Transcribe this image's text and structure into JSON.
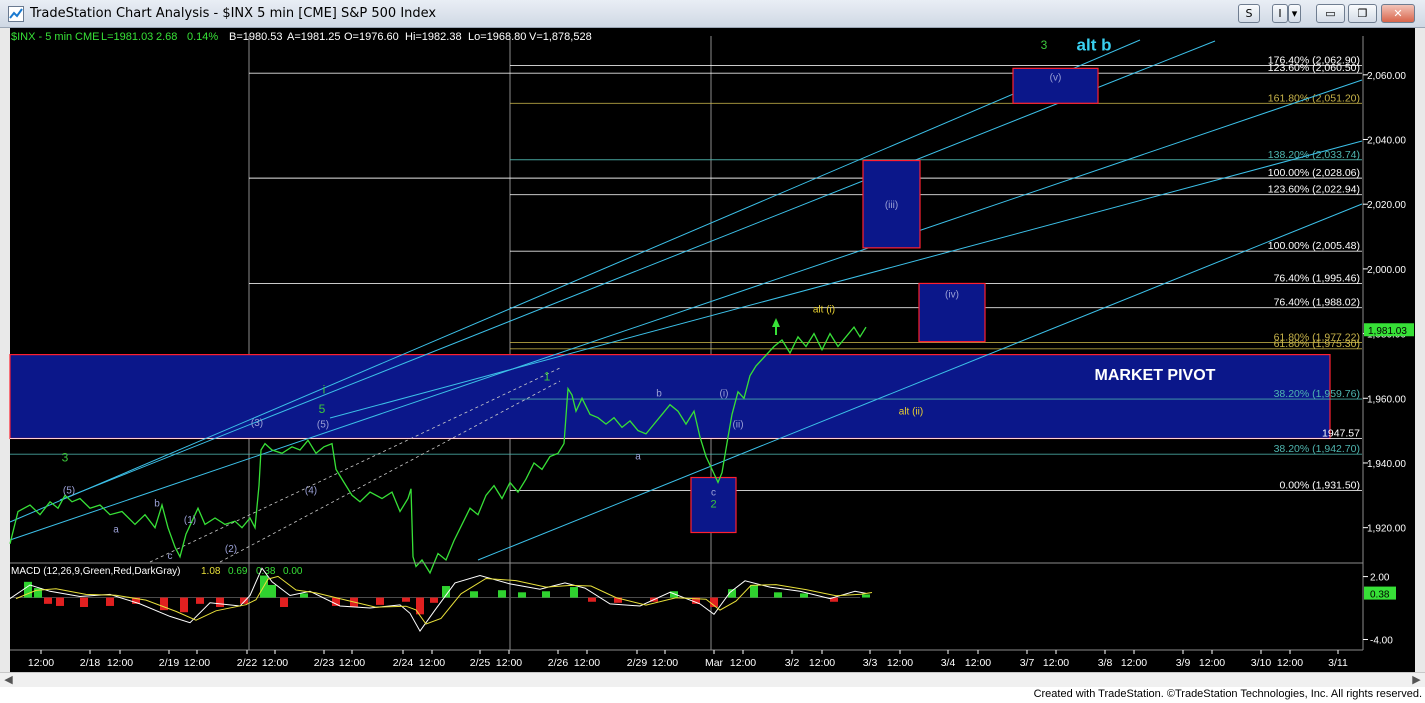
{
  "window": {
    "title": "TradeStation Chart Analysis - $INX 5 min [CME] S&P 500 Index",
    "btn_s": "S",
    "btn_i": "I",
    "btn_dropdown": "▾",
    "btn_minimize": "▭",
    "btn_restore": "❐",
    "btn_close": "✕"
  },
  "header": {
    "symbol": "$INX - 5 min",
    "exchange": "CME",
    "last": "L=1981.03",
    "change": "2.68",
    "pct": "0.14%",
    "bid": "B=1980.53",
    "ask": "A=1981.25",
    "open": "O=1976.60",
    "high": "Hi=1982.38",
    "low": "Lo=1968.80",
    "volume": "V=1,878,528"
  },
  "chart_data": {
    "type": "line",
    "price_axis": {
      "min": 1910,
      "max": 2072,
      "ticks": [
        1920,
        1940,
        1960,
        1980,
        2000,
        2020,
        2040,
        2060
      ],
      "tick_labels": [
        "1,920.00",
        "1,940.00",
        "1,960.00",
        "1,980.00",
        "2,000.00",
        "2,020.00",
        "2,040.00",
        "2,060.00"
      ],
      "last_price_label": "1,981.03"
    },
    "time_axis_labels": [
      "12:00",
      "2/18",
      "12:00",
      "2/19",
      "12:00",
      "2/22",
      "12:00",
      "2/23",
      "12:00",
      "2/24",
      "12:00",
      "2/25",
      "12:00",
      "2/26",
      "12:00",
      "2/29",
      "12:00",
      "Mar",
      "12:00",
      "3/2",
      "12:00",
      "3/3",
      "12:00",
      "3/4",
      "12:00",
      "3/7",
      "12:00",
      "3/8",
      "12:00",
      "3/9",
      "12:00",
      "3/10",
      "12:00",
      "3/11"
    ],
    "day_separators": [
      "2/22",
      "2/25",
      "Mar"
    ],
    "price_series": [
      [
        0,
        1915
      ],
      [
        8,
        1925
      ],
      [
        20,
        1927
      ],
      [
        30,
        1924
      ],
      [
        40,
        1928
      ],
      [
        48,
        1926
      ],
      [
        55,
        1930
      ],
      [
        62,
        1928
      ],
      [
        70,
        1929
      ],
      [
        80,
        1926
      ],
      [
        90,
        1927
      ],
      [
        100,
        1924
      ],
      [
        112,
        1925
      ],
      [
        125,
        1921
      ],
      [
        135,
        1924
      ],
      [
        145,
        1920
      ],
      [
        152,
        1927
      ],
      [
        158,
        1920
      ],
      [
        165,
        1914
      ],
      [
        170,
        1911
      ],
      [
        176,
        1918
      ],
      [
        182,
        1922
      ],
      [
        188,
        1926
      ],
      [
        195,
        1921
      ],
      [
        205,
        1923
      ],
      [
        215,
        1921
      ],
      [
        225,
        1922
      ],
      [
        232,
        1920
      ],
      [
        240,
        1923
      ],
      [
        245,
        1920
      ],
      [
        249,
        1933
      ],
      [
        251,
        1944
      ],
      [
        255,
        1946
      ],
      [
        262,
        1944
      ],
      [
        272,
        1943
      ],
      [
        282,
        1945
      ],
      [
        290,
        1944
      ],
      [
        298,
        1947
      ],
      [
        306,
        1943
      ],
      [
        314,
        1945
      ],
      [
        322,
        1946
      ],
      [
        326,
        1938
      ],
      [
        334,
        1934
      ],
      [
        342,
        1930
      ],
      [
        350,
        1928
      ],
      [
        360,
        1931
      ],
      [
        372,
        1929
      ],
      [
        382,
        1931
      ],
      [
        390,
        1925
      ],
      [
        398,
        1929
      ],
      [
        401,
        1932
      ],
      [
        403,
        1911
      ],
      [
        406,
        1908
      ],
      [
        412,
        1910
      ],
      [
        420,
        1906
      ],
      [
        428,
        1912
      ],
      [
        436,
        1910
      ],
      [
        444,
        1916
      ],
      [
        452,
        1921
      ],
      [
        460,
        1926
      ],
      [
        468,
        1924
      ],
      [
        476,
        1930
      ],
      [
        484,
        1933
      ],
      [
        492,
        1929
      ],
      [
        500,
        1934
      ],
      [
        508,
        1931
      ],
      [
        516,
        1935
      ],
      [
        524,
        1940
      ],
      [
        532,
        1938
      ],
      [
        540,
        1942
      ],
      [
        548,
        1943
      ],
      [
        554,
        1946
      ],
      [
        558,
        1963
      ],
      [
        562,
        1961
      ],
      [
        566,
        1956
      ],
      [
        572,
        1960
      ],
      [
        580,
        1955
      ],
      [
        588,
        1954
      ],
      [
        596,
        1952
      ],
      [
        604,
        1954
      ],
      [
        612,
        1951
      ],
      [
        620,
        1953
      ],
      [
        628,
        1950
      ],
      [
        636,
        1949
      ],
      [
        644,
        1952
      ],
      [
        652,
        1955
      ],
      [
        660,
        1958
      ],
      [
        668,
        1956
      ],
      [
        676,
        1952
      ],
      [
        684,
        1956
      ],
      [
        690,
        1948
      ],
      [
        696,
        1942
      ],
      [
        702,
        1938
      ],
      [
        708,
        1934
      ],
      [
        712,
        1937
      ],
      [
        718,
        1948
      ],
      [
        722,
        1955
      ],
      [
        728,
        1962
      ],
      [
        734,
        1960
      ],
      [
        740,
        1967
      ],
      [
        746,
        1970
      ],
      [
        752,
        1972
      ],
      [
        758,
        1974
      ],
      [
        764,
        1976
      ],
      [
        772,
        1978
      ],
      [
        780,
        1974
      ],
      [
        788,
        1979
      ],
      [
        796,
        1976
      ],
      [
        804,
        1980
      ],
      [
        812,
        1975
      ],
      [
        820,
        1980
      ],
      [
        828,
        1976
      ],
      [
        836,
        1979
      ],
      [
        844,
        1982
      ],
      [
        850,
        1979
      ],
      [
        856,
        1982
      ]
    ],
    "macd": {
      "label": "MACD (12,26,9,Green,Red,DarkGray)",
      "macd": "1.08",
      "signal": "0.69",
      "diff": "0.38",
      "zero": "0.00",
      "axis_min": -5.0,
      "axis_max": 3.2,
      "ticks": [
        2.0,
        -4.0
      ],
      "tick_labels": [
        "2.00",
        "-4.00"
      ],
      "last_label": "0.38"
    },
    "fib_levels": [
      {
        "label": "176.40% (2,062.90)",
        "price": 2062.9,
        "start": "2/25",
        "color": "#ffffff"
      },
      {
        "label": "123.60% (2,060.50)",
        "price": 2060.5,
        "start": "2/22",
        "color": "#ffffff"
      },
      {
        "label": "161.80% (2,051.20)",
        "price": 2051.2,
        "start": "2/25",
        "color": "#c8b44a"
      },
      {
        "label": "138.20% (2,033.74)",
        "price": 2033.74,
        "start": "2/25",
        "color": "#4fb6b0"
      },
      {
        "label": "100.00% (2,028.06)",
        "price": 2028.06,
        "start": "2/22",
        "color": "#ffffff"
      },
      {
        "label": "123.60% (2,022.94)",
        "price": 2022.94,
        "start": "2/25",
        "color": "#ffffff"
      },
      {
        "label": "100.00% (2,005.48)",
        "price": 2005.48,
        "start": "2/25",
        "color": "#ffffff"
      },
      {
        "label": "76.40% (1,995.46)",
        "price": 1995.46,
        "start": "2/22",
        "color": "#ffffff"
      },
      {
        "label": "76.40% (1,988.02)",
        "price": 1988.02,
        "start": "2/25",
        "color": "#ffffff"
      },
      {
        "label": "61.80% (1,977.22)",
        "price": 1977.22,
        "start": "2/25",
        "color": "#c8b44a"
      },
      {
        "label": "61.80% (1,975.30)",
        "price": 1975.3,
        "start": "2/25",
        "color": "#c8b44a"
      },
      {
        "label": "38.20% (1,959.76)",
        "price": 1959.76,
        "start": "2/25",
        "color": "#4fb6b0"
      },
      {
        "label": "1947.57",
        "price": 1947.57,
        "start": "start",
        "color": "#ffffff"
      },
      {
        "label": "38.20% (1,942.70)",
        "price": 1942.7,
        "start": "start",
        "color": "#4fb6b0"
      },
      {
        "label": "0.00% (1,931.50)",
        "price": 1931.5,
        "start": "2/25",
        "color": "#ffffff"
      }
    ],
    "market_pivot": {
      "label": "MARKET PIVOT",
      "top": 1973.5,
      "bottom": 1947.57
    },
    "target_boxes": [
      {
        "label": "(iii)",
        "from": 2006.5,
        "to": 2033.5
      },
      {
        "label": "(iv)",
        "from": 1977.5,
        "to": 1995.5
      },
      {
        "label": "(v)",
        "from": 2051.2,
        "to": 2062.0
      },
      {
        "label": "c",
        "sublabel": "2",
        "from": 1918.5,
        "to": 1935.5
      }
    ],
    "wave_labels": [
      {
        "text": "3",
        "color": "#3cc83c",
        "price": 1940.5
      },
      {
        "text": "(5)",
        "color": "#9aa0d6",
        "price": 1930.5
      },
      {
        "text": "b",
        "color": "#9aa0d6",
        "price": 1926.5
      },
      {
        "text": "a",
        "color": "#9aa0d6",
        "price": 1918.5
      },
      {
        "text": "(1)",
        "color": "#9aa0d6",
        "price": 1921.5
      },
      {
        "text": "c",
        "color": "#9aa0d6",
        "price": 1910.3
      },
      {
        "text": "(2)",
        "color": "#9aa0d6",
        "price": 1912.5
      },
      {
        "text": "(3)",
        "color": "#9aa0d6",
        "price": 1951.5
      },
      {
        "text": "i",
        "color": "#3cc83c",
        "price": 1961.5
      },
      {
        "text": "5",
        "color": "#3cc83c",
        "price": 1955.5
      },
      {
        "text": "(5)",
        "color": "#9aa0d6",
        "price": 1951.0
      },
      {
        "text": "(4)",
        "color": "#9aa0d6",
        "price": 1930.5
      },
      {
        "text": "1",
        "color": "#3cc83c",
        "price": 1965.5
      },
      {
        "text": "b",
        "color": "#9aa0d6",
        "price": 1960.5
      },
      {
        "text": "a",
        "color": "#9aa0d6",
        "price": 1941.0
      },
      {
        "text": "(i)",
        "color": "#9aa0d6",
        "price": 1960.5
      },
      {
        "text": "(ii)",
        "color": "#9aa0d6",
        "price": 1951.0
      },
      {
        "text": "alt (i)",
        "color": "#e8d030",
        "price": 1986.5
      },
      {
        "text": "alt (ii)",
        "color": "#e8d030",
        "price": 1955.0
      },
      {
        "text": "alt b",
        "color": "#3ad0f0",
        "price": 2067.5
      },
      {
        "text": "3",
        "color": "#3cc83c",
        "price": 2068.0
      }
    ]
  },
  "footer": {
    "text": "Created with TradeStation. ©TradeStation Technologies, Inc. All rights reserved."
  },
  "colors": {
    "background": "#000000",
    "price_line": "#37e037",
    "pivot_fill": "#0b178a",
    "box_border": "#ff2030",
    "channel": "#3cc0e8",
    "axis_text": "#ffffff"
  },
  "icons": [
    "chart-app-icon",
    "scroll-left-icon",
    "scroll-right-icon"
  ]
}
